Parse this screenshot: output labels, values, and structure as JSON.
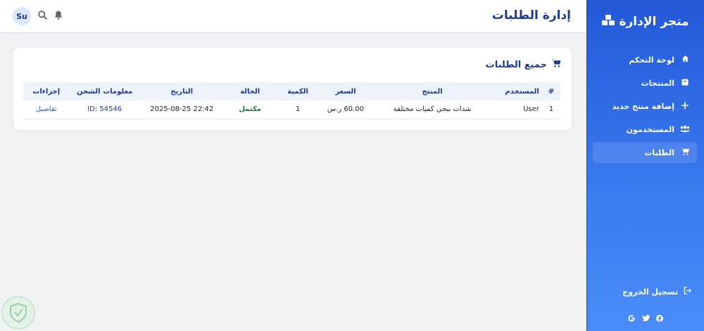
{
  "sidebar": {
    "brand": "متجر الإدارة",
    "brand_icon": "cubes-icon",
    "items": [
      {
        "label": "لوحة التحكم",
        "icon": "home-icon"
      },
      {
        "label": "المنتجات",
        "icon": "box-icon"
      },
      {
        "label": "إضافة منتج جديد",
        "icon": "plus-icon"
      },
      {
        "label": "المستخدمون",
        "icon": "users-icon"
      },
      {
        "label": "الطلبات",
        "icon": "cart-icon",
        "active": true
      }
    ],
    "logout": "تسجيل الخروج",
    "socials": [
      "facebook-icon",
      "twitter-icon",
      "google-icon"
    ]
  },
  "header": {
    "title": "إدارة الطلبات",
    "avatar": "Su"
  },
  "card": {
    "title": "جميع الطلبات"
  },
  "table": {
    "columns": [
      "#",
      "المستخدم",
      "المنتج",
      "السعر",
      "الكمية",
      "الحالة",
      "التاريخ",
      "معلومات الشحن",
      "إجراءات"
    ],
    "rows": [
      {
        "idx": "1",
        "user": "User",
        "product": "شدات ببجي كميات مختلفة",
        "price": "60.00 ر.س",
        "qty": "1",
        "status": "مكتمل",
        "date": "2025-08-25 22:42",
        "shipping": "ID: 54546",
        "action": "تفاصيل"
      }
    ]
  },
  "colors": {
    "sidebar_top": "#2358d8",
    "sidebar_bottom": "#4a8cf7",
    "heading": "#1e3a8a",
    "status_complete": "#1a7f2e"
  }
}
